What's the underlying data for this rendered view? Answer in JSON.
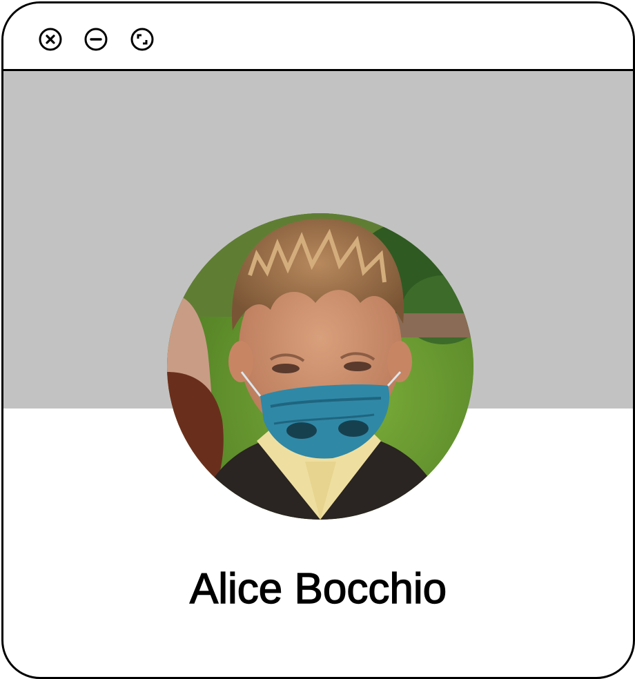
{
  "window": {
    "controls": {
      "close_icon": "close-circle-icon",
      "minimize_icon": "minimize-circle-icon",
      "maximize_icon": "maximize-circle-icon"
    }
  },
  "profile": {
    "name": "Alice Bocchio",
    "banner_color": "#c2c2c2",
    "avatar_icon": "profile-photo"
  },
  "colors": {
    "border": "#000000",
    "background": "#ffffff",
    "banner": "#c2c2c2"
  }
}
